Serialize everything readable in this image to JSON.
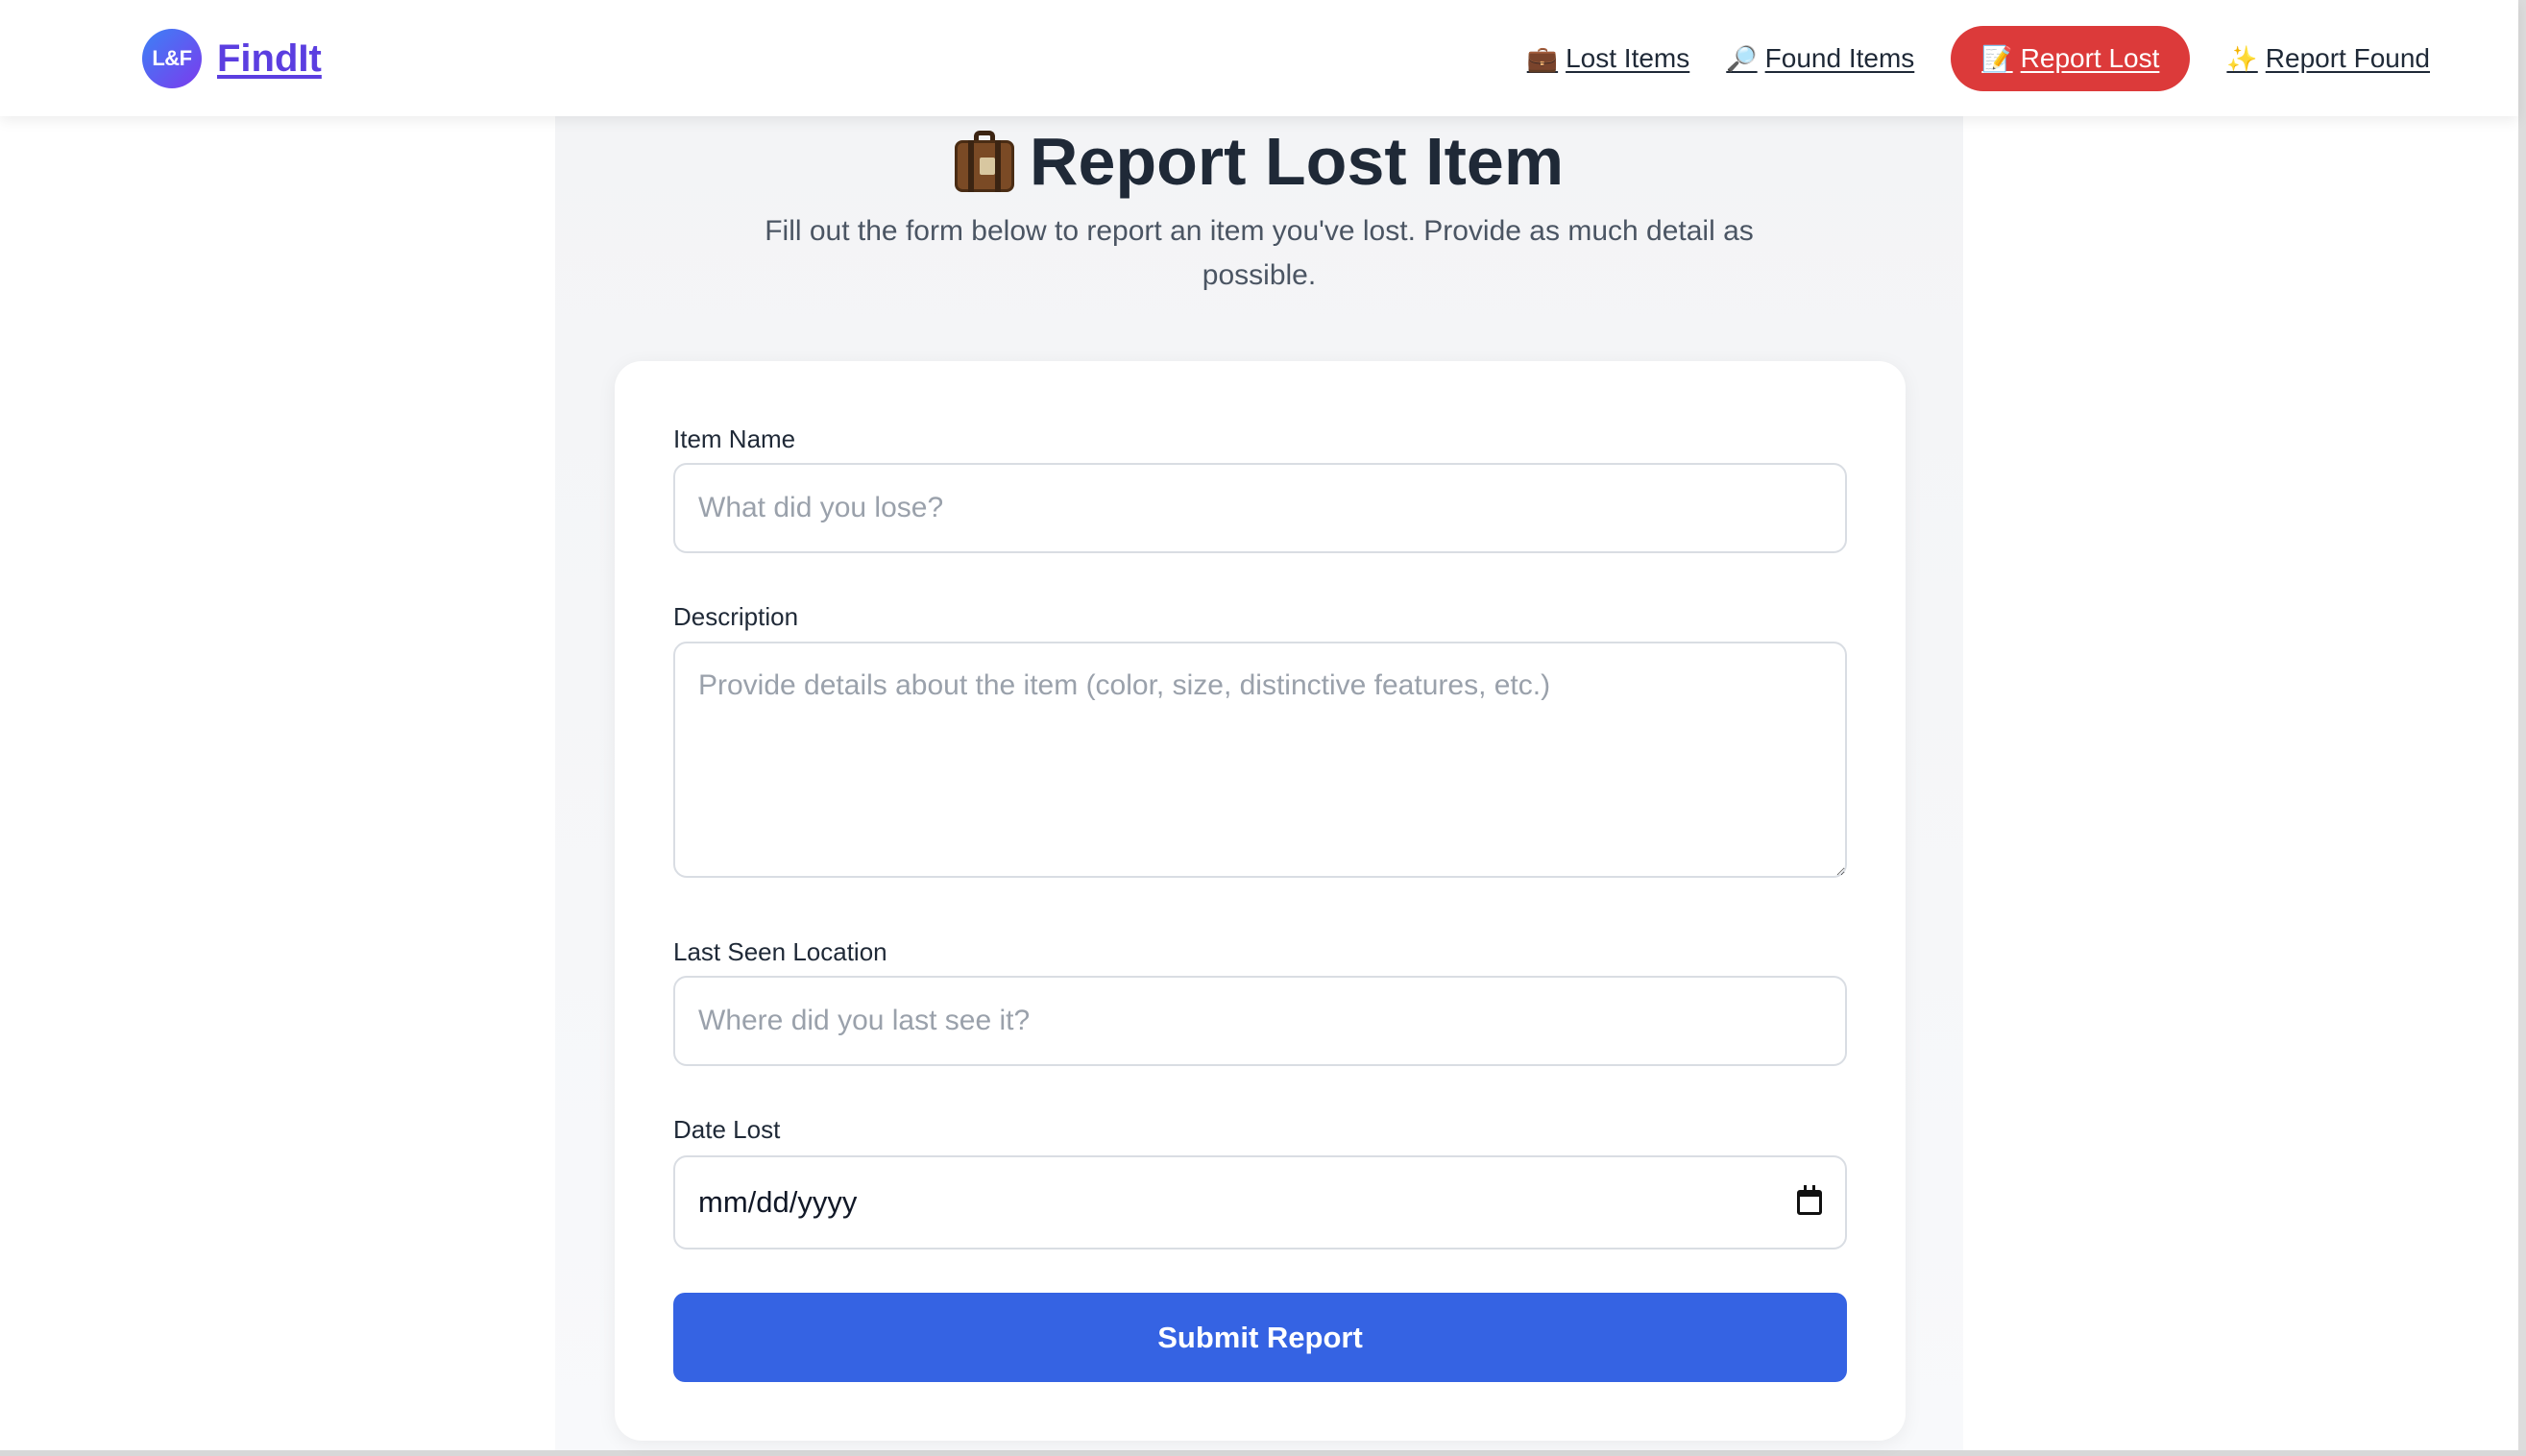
{
  "header": {
    "logo_text": "L&F",
    "brand_name": "FindIt",
    "nav": [
      {
        "icon": "💼",
        "icon_name": "briefcase-icon",
        "label": "Lost Items"
      },
      {
        "icon": "🔎",
        "icon_name": "magnifier-icon",
        "label": "Found Items"
      },
      {
        "icon": "📝",
        "icon_name": "memo-icon",
        "label": "Report Lost"
      },
      {
        "icon": "✨",
        "icon_name": "sparkles-icon",
        "label": "Report Found"
      }
    ],
    "active_nav": "Report Lost"
  },
  "page": {
    "title": "Report Lost Item",
    "title_icon": "suitcase-icon",
    "subtitle": "Fill out the form below to report an item you've lost. Provide as much detail as possible."
  },
  "form": {
    "item_name": {
      "label": "Item Name",
      "value": "",
      "placeholder": "What did you lose?"
    },
    "description": {
      "label": "Description",
      "value": "",
      "placeholder": "Provide details about the item (color, size, distinctive features, etc.)"
    },
    "location": {
      "label": "Last Seen Location",
      "value": "",
      "placeholder": "Where did you last see it?"
    },
    "date_lost": {
      "label": "Date Lost",
      "value": "mm/dd/yyyy",
      "icon": "calendar-icon"
    },
    "submit_label": "Submit Report"
  },
  "colors": {
    "accent_blue": "#3563e3",
    "active_nav_red": "#dc3a3a",
    "brand_purple": "#5b3ee0",
    "page_background": "#f3f4f6"
  }
}
